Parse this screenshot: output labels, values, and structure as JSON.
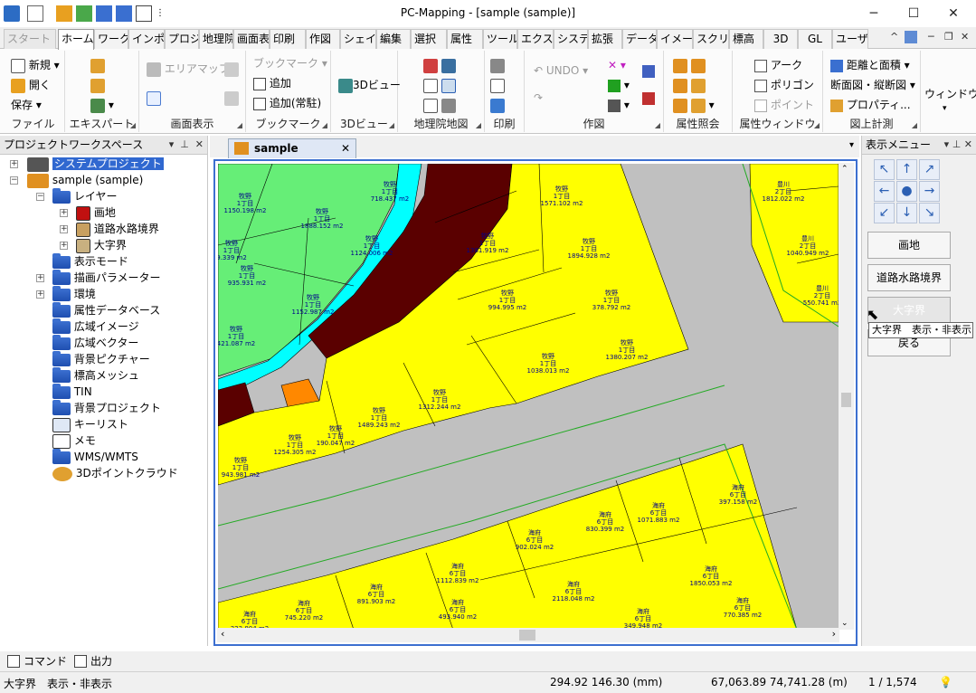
{
  "window": {
    "title": "PC-Mapping - [sample (sample)]",
    "minimize": "─",
    "maximize": "☐",
    "close": "✕"
  },
  "ribbon_tabs": [
    "スタート",
    "ホーム",
    "ワークス",
    "インポー",
    "プロジ",
    "地理院",
    "画面表",
    "印刷",
    "作図",
    "シェイ",
    "編集",
    "選択",
    "属性",
    "ツール",
    "エクスパ",
    "システ",
    "拡張",
    "データ",
    "イメー",
    "スクリ",
    "標高",
    "3D",
    "GL",
    "ユーザ-"
  ],
  "ribbon_right": {
    "collapse": "^",
    "min": "─",
    "restore": "❐",
    "close": "✕"
  },
  "ribbon": {
    "file": {
      "label": "ファイル",
      "new": "新規",
      "open": "開く",
      "save": "保存"
    },
    "export": {
      "label": "エキスパート"
    },
    "view": {
      "label": "画面表示",
      "area_map": "エリアマップ"
    },
    "bookmark": {
      "label": "ブックマーク",
      "bookmark": "ブックマーク",
      "add": "追加",
      "add_always": "追加(常駐)"
    },
    "view3d": {
      "label": "3Dビュー",
      "button": "3Dビュー"
    },
    "gsi": {
      "label": "地理院地図"
    },
    "print": {
      "label": "印刷"
    },
    "draw": {
      "label": "作図",
      "undo": "UNDO"
    },
    "attr": {
      "label": "属性照会"
    },
    "attrwin": {
      "label": "属性ウィンドウ",
      "arc": "アーク",
      "polygon": "ポリゴン",
      "point": "ポイント"
    },
    "measure": {
      "label": "図上計測",
      "dist_area": "距離と面積",
      "section": "断面図・縦断図",
      "property": "プロパティ..."
    },
    "window": {
      "label": "ウィンドウ"
    }
  },
  "left_panel": {
    "title": "プロジェクトワークスペース",
    "tree": [
      {
        "label": "システムプロジェクト",
        "selected": true
      },
      {
        "label": "sample (sample)"
      },
      {
        "label": "レイヤー"
      },
      {
        "label": "画地"
      },
      {
        "label": "道路水路境界"
      },
      {
        "label": "大字界"
      },
      {
        "label": "表示モード"
      },
      {
        "label": "描画パラメーター"
      },
      {
        "label": "環境"
      },
      {
        "label": "属性データベース"
      },
      {
        "label": "広域イメージ"
      },
      {
        "label": "広域ベクター"
      },
      {
        "label": "背景ピクチャー"
      },
      {
        "label": "標高メッシュ"
      },
      {
        "label": "TIN"
      },
      {
        "label": "背景プロジェクト"
      },
      {
        "label": "キーリスト"
      },
      {
        "label": "メモ"
      },
      {
        "label": "WMS/WMTS"
      },
      {
        "label": "3Dポイントクラウド"
      }
    ]
  },
  "document": {
    "tab": "sample (sample)",
    "parcels": [
      {
        "name": "牧野",
        "block": "1丁目",
        "area": "1150.198 m2"
      },
      {
        "name": "牧野",
        "block": "1丁目",
        "area": "1888.152 m2"
      },
      {
        "name": "牧野",
        "block": "1丁目",
        "area": "718.437 m2"
      },
      {
        "name": "牧野",
        "block": "1丁目",
        "area": "1571.102 m2"
      },
      {
        "name": "豊川",
        "block": "2丁目",
        "area": "1812.022 m2"
      },
      {
        "name": "牧野",
        "block": "1丁目",
        "area": "1124.006 m2"
      },
      {
        "name": "牧野",
        "block": "1丁目",
        "area": "9.339 m2"
      },
      {
        "name": "牧野",
        "block": "1丁目",
        "area": "1381.919 m2"
      },
      {
        "name": "牧野",
        "block": "1丁目",
        "area": "1894.928 m2"
      },
      {
        "name": "豊川",
        "block": "2丁目",
        "area": "1040.949 m2"
      },
      {
        "name": "牧野",
        "block": "1丁目",
        "area": "935.931 m2"
      },
      {
        "name": "牧野",
        "block": "1丁目",
        "area": "1152.987 m2"
      },
      {
        "name": "牧野",
        "block": "1丁目",
        "area": "994.995 m2"
      },
      {
        "name": "牧野",
        "block": "1丁目",
        "area": "378.792 m2"
      },
      {
        "name": "豊川",
        "block": "2丁目",
        "area": "550.741 m2"
      },
      {
        "name": "牧野",
        "block": "1丁目",
        "area": "421.087 m2"
      },
      {
        "name": "牧野",
        "block": "1丁目",
        "area": "1380.207 m2"
      },
      {
        "name": "牧野",
        "block": "1丁目",
        "area": "1038.013 m2"
      },
      {
        "name": "牧野",
        "block": "1丁目",
        "area": "1312.244 m2"
      },
      {
        "name": "牧野",
        "block": "1丁目",
        "area": "1489.243 m2"
      },
      {
        "name": "牧野",
        "block": "1丁目",
        "area": "1254.305 m2"
      },
      {
        "name": "牧野",
        "block": "1丁目",
        "area": "190.047 m2"
      },
      {
        "name": "牧野",
        "block": "1丁目",
        "area": "943.981 m2"
      },
      {
        "name": "海府",
        "block": "6丁目",
        "area": "397.158 m2"
      },
      {
        "name": "海府",
        "block": "6丁目",
        "area": "1071.883 m2"
      },
      {
        "name": "海府",
        "block": "6丁目",
        "area": "830.399 m2"
      },
      {
        "name": "海府",
        "block": "6丁目",
        "area": "902.024 m2"
      },
      {
        "name": "海府",
        "block": "6丁目",
        "area": "1112.839 m2"
      },
      {
        "name": "海府",
        "block": "6丁目",
        "area": "1850.053 m2"
      },
      {
        "name": "海府",
        "block": "6丁目",
        "area": "2118.048 m2"
      },
      {
        "name": "海府",
        "block": "6丁目",
        "area": "891.903 m2"
      },
      {
        "name": "海府",
        "block": "6丁目",
        "area": "493.940 m2"
      },
      {
        "name": "海府",
        "block": "6丁目",
        "area": "745.220 m2"
      },
      {
        "name": "海府",
        "block": "6丁目",
        "area": "323.804 m2"
      },
      {
        "name": "海府",
        "block": "6丁目",
        "area": "349.948 m2"
      },
      {
        "name": "海府",
        "block": "6丁目",
        "area": "770.385 m2"
      }
    ],
    "colors": {
      "parcel": "#ffff00",
      "road": "#c0c0c0",
      "water": "#00ffff",
      "green": "#66ee77",
      "dark": "#5a0000",
      "orange": "#ff8800",
      "boundary": "#22aa22"
    }
  },
  "right_panel": {
    "title": "表示メニュー",
    "buttons": [
      "画地",
      "道路水路境界",
      "大字界",
      "戻る"
    ],
    "tooltip": "大字界　表示・非表示"
  },
  "bottom_tabs": [
    "コマンド",
    "出力"
  ],
  "status": {
    "message": "大字界　表示・非表示",
    "mm": "294.92 146.30 (mm)",
    "coords": "67,063.89 74,741.28 (m)",
    "scale": "1 / 1,574"
  }
}
